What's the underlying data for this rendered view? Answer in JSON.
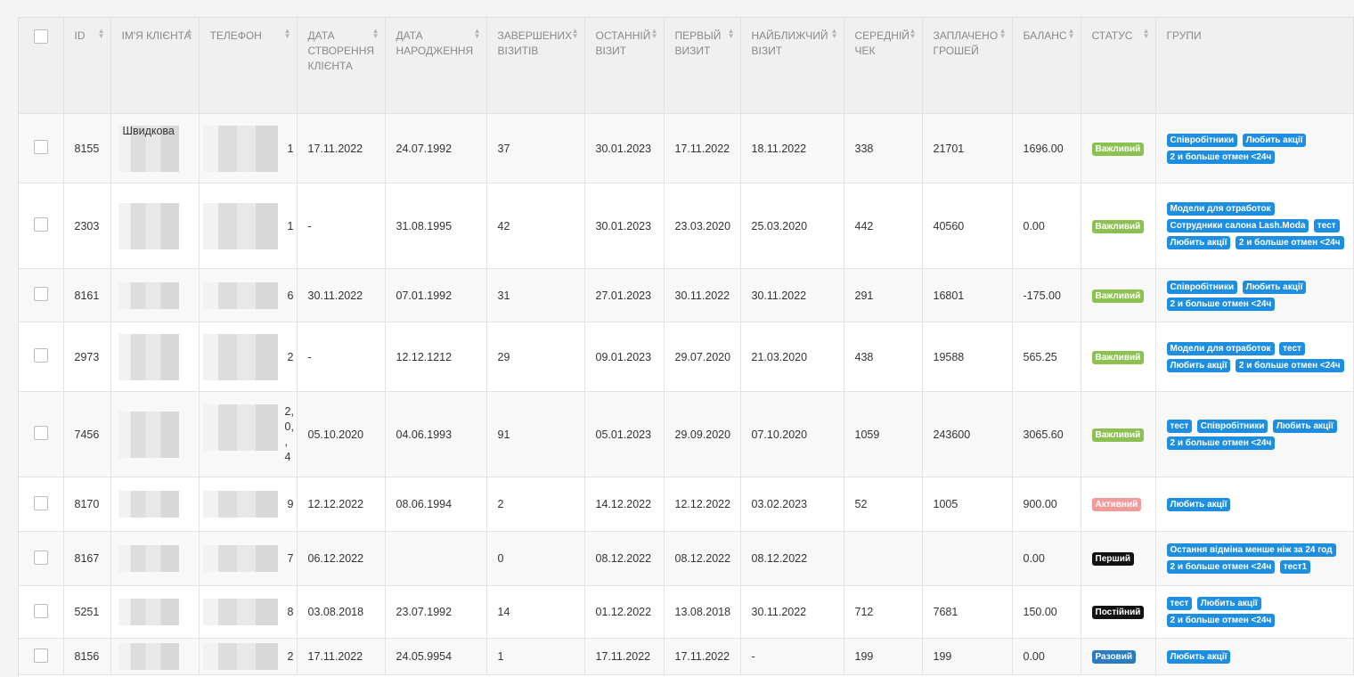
{
  "columns": [
    {
      "key": "id",
      "label": "ID"
    },
    {
      "key": "name",
      "label": "ІМ'Я КЛІЄНТА"
    },
    {
      "key": "phone",
      "label": "ТЕЛЕФОН"
    },
    {
      "key": "created",
      "label": "ДАТА СТВОРЕННЯ КЛІЄНТА"
    },
    {
      "key": "birthday",
      "label": "ДАТА НАРОДЖЕННЯ"
    },
    {
      "key": "completed",
      "label": "ЗАВЕРШЕНИХ ВІЗИТІВ"
    },
    {
      "key": "last_visit",
      "label": "ОСТАННІЙ ВІЗИТ"
    },
    {
      "key": "first_visit",
      "label": "ПЕРВЫЙ ВИЗИТ"
    },
    {
      "key": "next_visit",
      "label": "НАЙБЛИЖЧИЙ ВІЗИТ"
    },
    {
      "key": "avg_check",
      "label": "СЕРЕДНІЙ ЧЕК"
    },
    {
      "key": "paid",
      "label": "ЗАПЛАЧЕНО ГРОШЕЙ"
    },
    {
      "key": "balance",
      "label": "БАЛАНС"
    },
    {
      "key": "status",
      "label": "СТАТУС"
    },
    {
      "key": "groups",
      "label": "ГРУПИ"
    }
  ],
  "rows": [
    {
      "id": "8155",
      "name": "Швидкова",
      "phone_tail": "1",
      "created": "17.11.2022",
      "birthday": "24.07.1992",
      "completed": "37",
      "last_visit": "30.01.2023",
      "first_visit": "17.11.2022",
      "next_visit": "18.11.2022",
      "avg_check": "338",
      "paid": "21701",
      "balance": "1696.00",
      "status": "Важливий",
      "status_class": "st-important",
      "groups": [
        "Співробітники",
        "Любить акції",
        "2 и больше отмен <24ч"
      ]
    },
    {
      "id": "2303",
      "name": "",
      "phone_tail": "1",
      "created": "-",
      "birthday": "31.08.1995",
      "completed": "42",
      "last_visit": "30.01.2023",
      "first_visit": "23.03.2020",
      "next_visit": "25.03.2020",
      "avg_check": "442",
      "paid": "40560",
      "balance": "0.00",
      "status": "Важливий",
      "status_class": "st-important",
      "groups": [
        "Модели для отработок",
        "Сотрудники салона Lash.Moda",
        "тест",
        "Любить акції",
        "2 и больше отмен <24ч"
      ]
    },
    {
      "id": "8161",
      "name": "",
      "phone_tail": "6",
      "created": "30.11.2022",
      "birthday": "07.01.1992",
      "completed": "31",
      "last_visit": "27.01.2023",
      "first_visit": "30.11.2022",
      "next_visit": "30.11.2022",
      "avg_check": "291",
      "paid": "16801",
      "balance": "-175.00",
      "status": "Важливий",
      "status_class": "st-important",
      "groups": [
        "Співробітники",
        "Любить акції",
        "2 и больше отмен <24ч"
      ]
    },
    {
      "id": "2973",
      "name": "",
      "phone_tail": "2",
      "created": "-",
      "birthday": "12.12.1212",
      "completed": "29",
      "last_visit": "09.01.2023",
      "first_visit": "29.07.2020",
      "next_visit": "21.03.2020",
      "avg_check": "438",
      "paid": "19588",
      "balance": "565.25",
      "status": "Важливий",
      "status_class": "st-important",
      "groups": [
        "Модели для отработок",
        "тест",
        "Любить акції",
        "2 и больше отмен <24ч"
      ]
    },
    {
      "id": "7456",
      "name": "",
      "phone_tail": "2, 0, , 4",
      "created": "05.10.2020",
      "birthday": "04.06.1993",
      "completed": "91",
      "last_visit": "05.01.2023",
      "first_visit": "29.09.2020",
      "next_visit": "07.10.2020",
      "avg_check": "1059",
      "paid": "243600",
      "balance": "3065.60",
      "status": "Важливий",
      "status_class": "st-important",
      "groups": [
        "тест",
        "Співробітники",
        "Любить акції",
        "2 и больше отмен <24ч"
      ]
    },
    {
      "id": "8170",
      "name": "",
      "phone_tail": "9",
      "created": "12.12.2022",
      "birthday": "08.06.1994",
      "completed": "2",
      "last_visit": "14.12.2022",
      "first_visit": "12.12.2022",
      "next_visit": "03.02.2023",
      "avg_check": "52",
      "paid": "1005",
      "balance": "900.00",
      "status": "Активний",
      "status_class": "st-active",
      "groups": [
        "Любить акції"
      ]
    },
    {
      "id": "8167",
      "name": "",
      "phone_tail": "7",
      "created": "06.12.2022",
      "birthday": "",
      "completed": "0",
      "last_visit": "08.12.2022",
      "first_visit": "08.12.2022",
      "next_visit": "08.12.2022",
      "avg_check": "",
      "paid": "",
      "balance": "0.00",
      "status": "Перший",
      "status_class": "st-first",
      "groups": [
        "Остання відміна менше ніж за 24 год",
        "2 и больше отмен <24ч",
        "тест1"
      ]
    },
    {
      "id": "5251",
      "name": "",
      "phone_tail": "8",
      "created": "03.08.2018",
      "birthday": "23.07.1992",
      "completed": "14",
      "last_visit": "01.12.2022",
      "first_visit": "13.08.2018",
      "next_visit": "30.11.2022",
      "avg_check": "712",
      "paid": "7681",
      "balance": "150.00",
      "status": "Постійний",
      "status_class": "st-permanent",
      "groups": [
        "тест",
        "Любить акції",
        "2 и больше отмен <24ч"
      ]
    },
    {
      "id": "8156",
      "name": "",
      "phone_tail": "2",
      "created": "17.11.2022",
      "birthday": "24.05.9954",
      "completed": "1",
      "last_visit": "17.11.2022",
      "first_visit": "17.11.2022",
      "next_visit": "-",
      "avg_check": "199",
      "paid": "199",
      "balance": "0.00",
      "status": "Разовий",
      "status_class": "st-single",
      "groups": [
        "Любить акції"
      ]
    }
  ],
  "colors": {
    "group_badge": "#1e8fe0",
    "important": "#8cc152",
    "active": "#f39b9b",
    "first": "#111111",
    "permanent": "#111111",
    "single": "#2b7cc0"
  }
}
